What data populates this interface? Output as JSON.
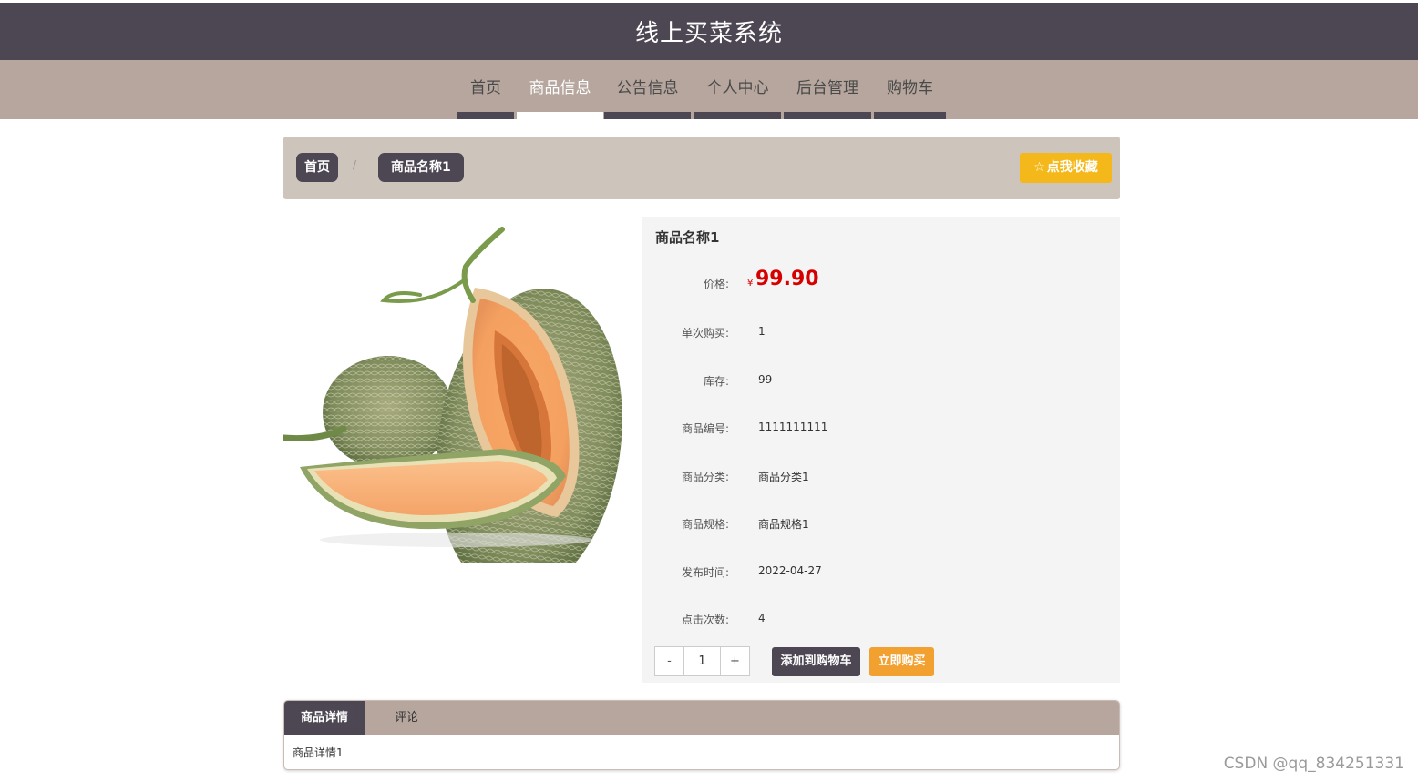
{
  "header": {
    "title": "线上买菜系统"
  },
  "nav": {
    "items": [
      {
        "label": "首页"
      },
      {
        "label": "商品信息"
      },
      {
        "label": "公告信息"
      },
      {
        "label": "个人中心"
      },
      {
        "label": "后台管理"
      },
      {
        "label": "购物车"
      }
    ],
    "active_index": 1
  },
  "breadcrumb": {
    "home": "首页",
    "separator": "/",
    "current": "商品名称1"
  },
  "favorite_button": {
    "label": "点我收藏",
    "icon": "star-outline-icon"
  },
  "product": {
    "image": "cantaloupe-melon-photo",
    "name": "商品名称1",
    "price_label": "价格:",
    "currency": "¥",
    "price": "99.90",
    "fields": [
      {
        "label": "单次购买:",
        "value": "1"
      },
      {
        "label": "库存:",
        "value": "99"
      },
      {
        "label": "商品编号:",
        "value": "1111111111"
      },
      {
        "label": "商品分类:",
        "value": "商品分类1"
      },
      {
        "label": "商品规格:",
        "value": "商品规格1"
      },
      {
        "label": "发布时间:",
        "value": "2022-04-27"
      },
      {
        "label": "点击次数:",
        "value": "4"
      }
    ]
  },
  "quantity": {
    "minus": "-",
    "value": "1",
    "plus": "+"
  },
  "actions": {
    "add_to_cart": "添加到购物车",
    "buy_now": "立即购买"
  },
  "tabs": {
    "items": [
      {
        "label": "商品详情"
      },
      {
        "label": "评论"
      }
    ],
    "content": "商品详情1"
  },
  "watermark": "CSDN @qq_834251331",
  "colors": {
    "header_bg": "#4d4653",
    "nav_bg": "#b6a69e",
    "breadcrumb_bg": "#cdc4bc",
    "favorite_bg": "#f5b81b",
    "price": "#d60000",
    "buy_bg": "#f2a030"
  }
}
